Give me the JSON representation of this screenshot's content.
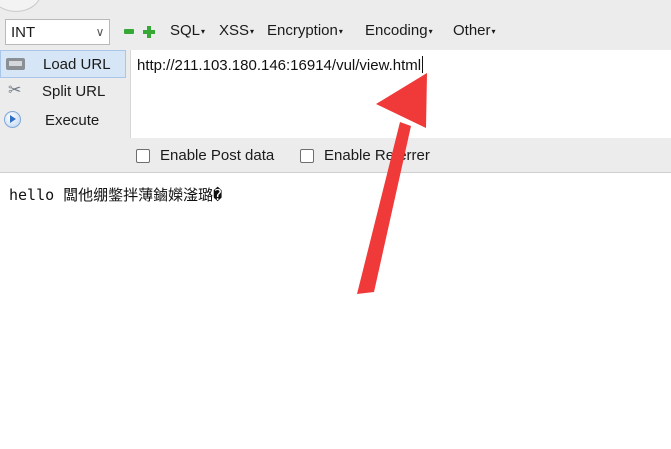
{
  "toolbar": {
    "select_value": "INT",
    "menus": [
      {
        "label": "SQL"
      },
      {
        "label": "XSS"
      },
      {
        "label": "Encryption"
      },
      {
        "label": "Encoding"
      },
      {
        "label": "Other"
      }
    ],
    "side_items": [
      {
        "label": "Load URL",
        "icon": "load-url-icon"
      },
      {
        "label": "Split URL",
        "icon": "split-url-icon"
      },
      {
        "label": "Execute",
        "icon": "execute-icon"
      }
    ],
    "url_value": "http://211.103.180.146:16914/vul/view.html",
    "checkboxes": [
      {
        "label": "Enable Post data",
        "checked": false
      },
      {
        "label": "Enable Referrer",
        "checked": false
      }
    ]
  },
  "page_content": {
    "text": "hello 闆他绷鐅拌薄鏀嬫滏璐�"
  },
  "colors": {
    "toolbar_bg": "#ececec",
    "accent_green": "#36a836",
    "annotation_arrow": "#f03a3a",
    "active_item_bg": "#d7e6f7"
  }
}
